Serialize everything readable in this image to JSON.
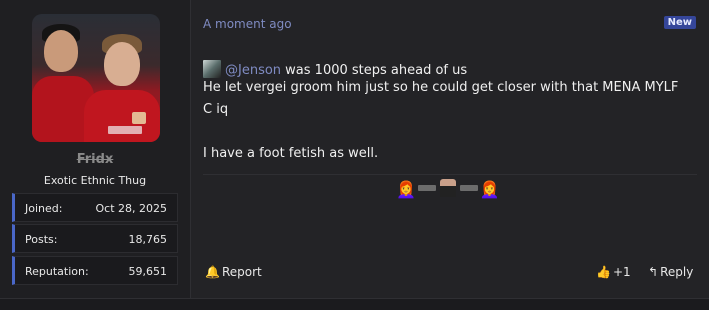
{
  "post": {
    "time": "A moment ago",
    "new_label": "New",
    "quote": {
      "mention": "@Jenson",
      "text": " was 1000 steps ahead of us"
    },
    "lines": [
      "He let vergei groom him just so he could get closer with that MENA MYLF",
      "C iq",
      "I have a foot fetish as well."
    ],
    "reactions": [
      "redhead-woman-emoji",
      "gun-man-reaction-image",
      "redhead-woman-emoji"
    ]
  },
  "user": {
    "name": "Fridx",
    "title": "Exotic Ethnic Thug",
    "stats": [
      {
        "label": "Joined:",
        "value": "Oct 28, 2025"
      },
      {
        "label": "Posts:",
        "value": "18,765"
      },
      {
        "label": "Reputation:",
        "value": "59,651"
      }
    ]
  },
  "actions": {
    "report": "Report",
    "like_count": "+1",
    "reply": "Reply"
  },
  "colors": {
    "accent": "#7f8bc2",
    "badge": "#35469a",
    "stat_border": "#4a67c8"
  }
}
